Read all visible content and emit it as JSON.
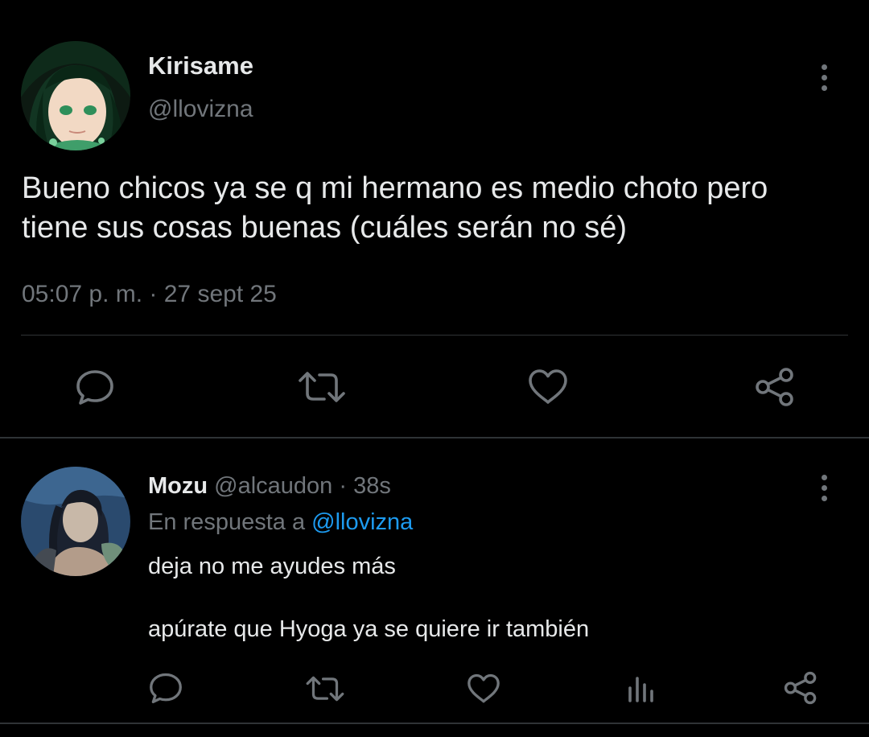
{
  "main_tweet": {
    "author_name": "Kirisame",
    "author_handle": "@llovizna",
    "text_lines": [
      "Bueno chicos ya se q mi hermano es medio choto pero",
      "tiene sus cosas buenas (cuáles serán no sé)"
    ],
    "timestamp": "05:07 p. m. · 27 sept 25",
    "actions": [
      "reply-icon",
      "retweet-icon",
      "like-icon",
      "share-icon"
    ]
  },
  "reply": {
    "author_name": "Mozu",
    "author_handle": "@alcaudon",
    "separator": " · ",
    "age": "38s",
    "in_reply_to_prefix": "En respuesta a ",
    "in_reply_to_mention": "@llovizna",
    "text_lines": [
      "deja no me ayudes más",
      "apúrate que Hyoga ya se quiere ir también"
    ],
    "actions": [
      "reply-icon",
      "retweet-icon",
      "like-icon",
      "analytics-icon",
      "share-icon"
    ]
  },
  "colors": {
    "background": "#000000",
    "primary_text": "#e7e9ea",
    "secondary_text": "#71767b",
    "link": "#1d9bf0",
    "divider": "#2f3336"
  }
}
